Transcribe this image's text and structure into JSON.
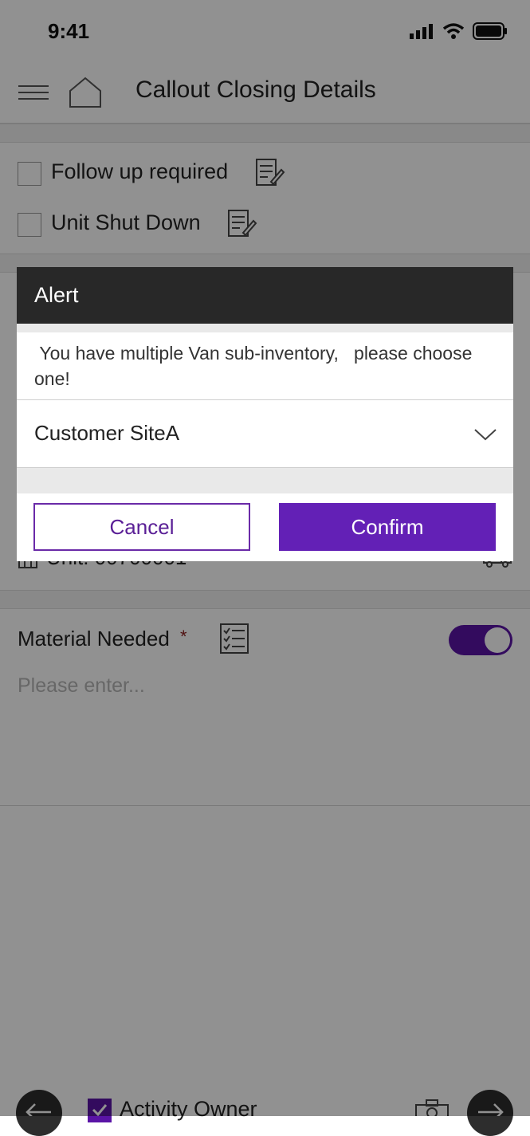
{
  "status_bar": {
    "time": "9:41"
  },
  "header": {
    "title": "Callout Closing Details",
    "menu_icon": "menu-icon",
    "home_icon": "home-icon"
  },
  "options": [
    {
      "label": "Follow up required",
      "icon": "edit-note-icon"
    },
    {
      "label": "Unit Shut Down",
      "icon": "edit-note-icon"
    }
  ],
  "unit_row": {
    "text": "Unit: 00700001"
  },
  "material": {
    "label": "Material Needed",
    "required_mark": "*",
    "placeholder": "Please enter...",
    "toggle_on": true
  },
  "bottom_bar": {
    "checkbox_label": "Activity Owner",
    "back_icon": "arrow-left-icon",
    "camera_icon": "camera-icon",
    "forward_icon": "arrow-right-icon"
  },
  "dialog": {
    "title": "Alert",
    "message": " You have multiple Van sub-inventory,   please choose one!",
    "select_value": "Customer SiteA",
    "cancel_label": "Cancel",
    "confirm_label": "Confirm"
  },
  "colors": {
    "accent": "#6320b6",
    "toggle": "#5a14a6",
    "required": "#8b1d1d",
    "dialog_header": "#282828"
  }
}
